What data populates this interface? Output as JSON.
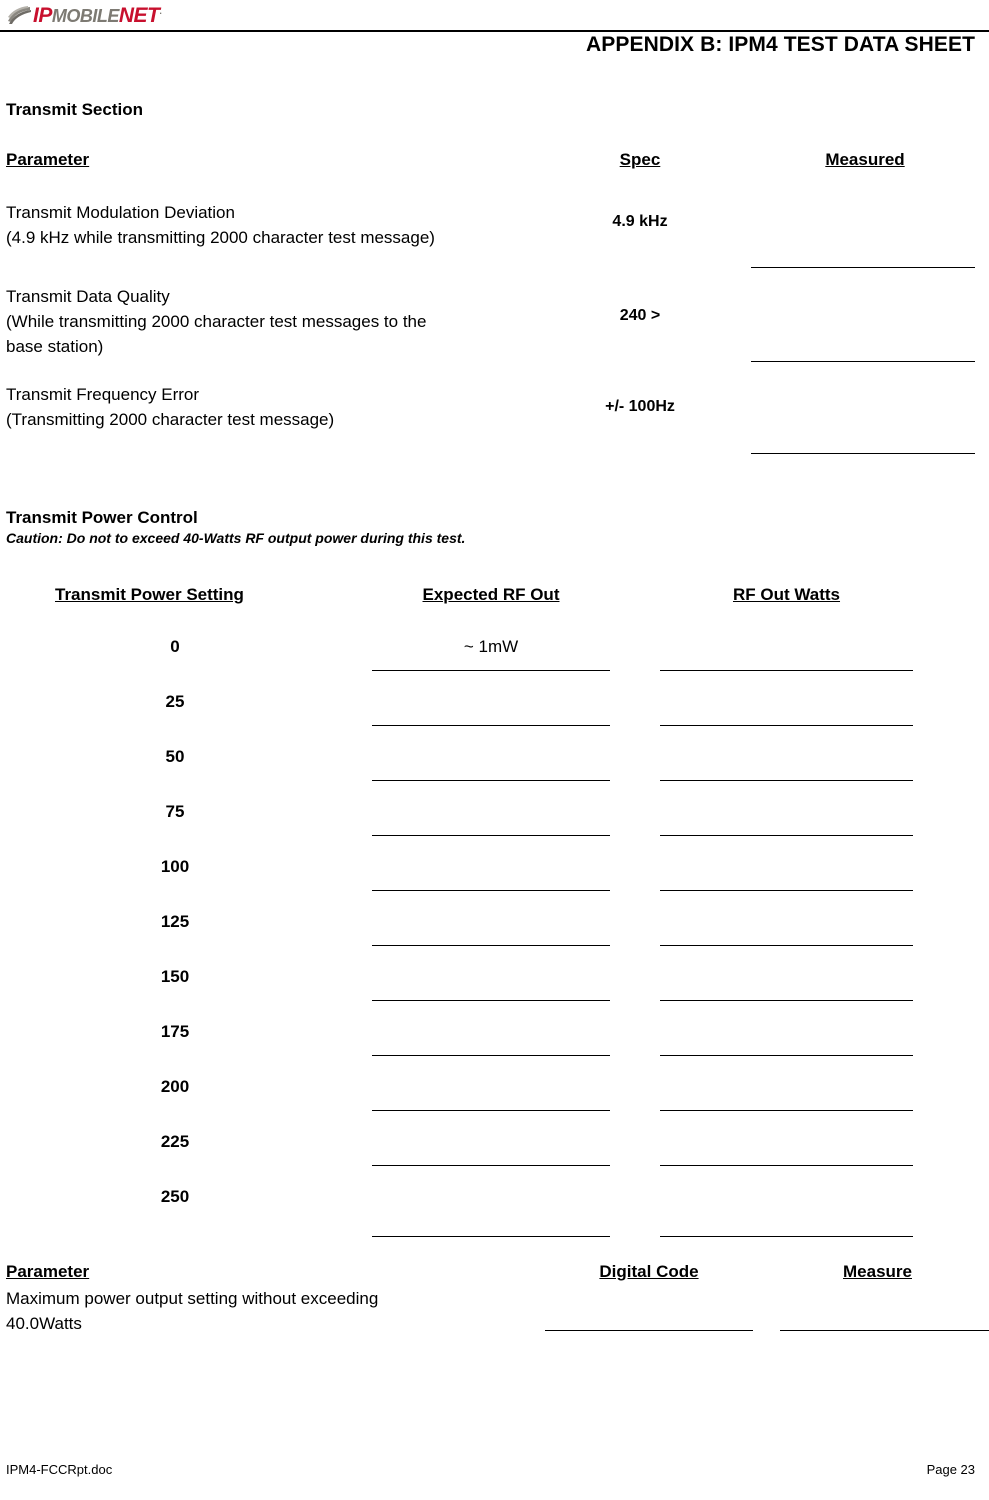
{
  "header": {
    "logo": {
      "part1": "IP",
      "part2": "MOBILE",
      "part3": "NET",
      "trademark": ".",
      "color_primary": "#c8102e",
      "color_secondary": "#7d7a73"
    },
    "title": "APPENDIX B:  IPM4 TEST DATA SHEET"
  },
  "transmit_section": {
    "heading": "Transmit Section",
    "columns": {
      "parameter": "Parameter",
      "spec": "Spec",
      "measured": "Measured"
    },
    "rows": [
      {
        "parameter_line1": "Transmit Modulation Deviation",
        "parameter_line2": "(4.9 kHz while transmitting 2000 character test message)",
        "parameter_line3": "",
        "spec": "4.9 kHz",
        "measured": ""
      },
      {
        "parameter_line1": "Transmit Data Quality",
        "parameter_line2": "(While transmitting 2000 character test messages to the",
        "parameter_line3": "base station)",
        "spec": "240 >",
        "measured": ""
      },
      {
        "parameter_line1": "Transmit Frequency Error",
        "parameter_line2": "(Transmitting 2000 character test message)",
        "parameter_line3": "",
        "spec": "+/- 100Hz",
        "measured": ""
      }
    ]
  },
  "power_control_section": {
    "heading": "Transmit Power Control",
    "caution": "Caution: Do not to exceed 40-Watts RF output power during this test.",
    "columns": {
      "setting": "Transmit Power Setting",
      "expected": "Expected RF Out",
      "watts": "RF Out Watts"
    },
    "rows": [
      {
        "setting": "0",
        "expected": "~ 1mW",
        "watts": ""
      },
      {
        "setting": "25",
        "expected": "",
        "watts": ""
      },
      {
        "setting": "50",
        "expected": "",
        "watts": ""
      },
      {
        "setting": "75",
        "expected": "",
        "watts": ""
      },
      {
        "setting": "100",
        "expected": "",
        "watts": ""
      },
      {
        "setting": "125",
        "expected": "",
        "watts": ""
      },
      {
        "setting": "150",
        "expected": "",
        "watts": ""
      },
      {
        "setting": "175",
        "expected": "",
        "watts": ""
      },
      {
        "setting": "200",
        "expected": "",
        "watts": ""
      },
      {
        "setting": "225",
        "expected": "",
        "watts": ""
      },
      {
        "setting": "250",
        "expected": "",
        "watts": ""
      }
    ]
  },
  "max_power_section": {
    "columns": {
      "parameter": "Parameter",
      "digital_code": "Digital Code",
      "measure": "Measure"
    },
    "parameter_line1": "Maximum power output setting without exceeding",
    "parameter_line2": "40.0Watts",
    "digital_code": "",
    "measure": ""
  },
  "footer": {
    "filename": "IPM4-FCCRpt.doc",
    "page": "Page 23"
  }
}
